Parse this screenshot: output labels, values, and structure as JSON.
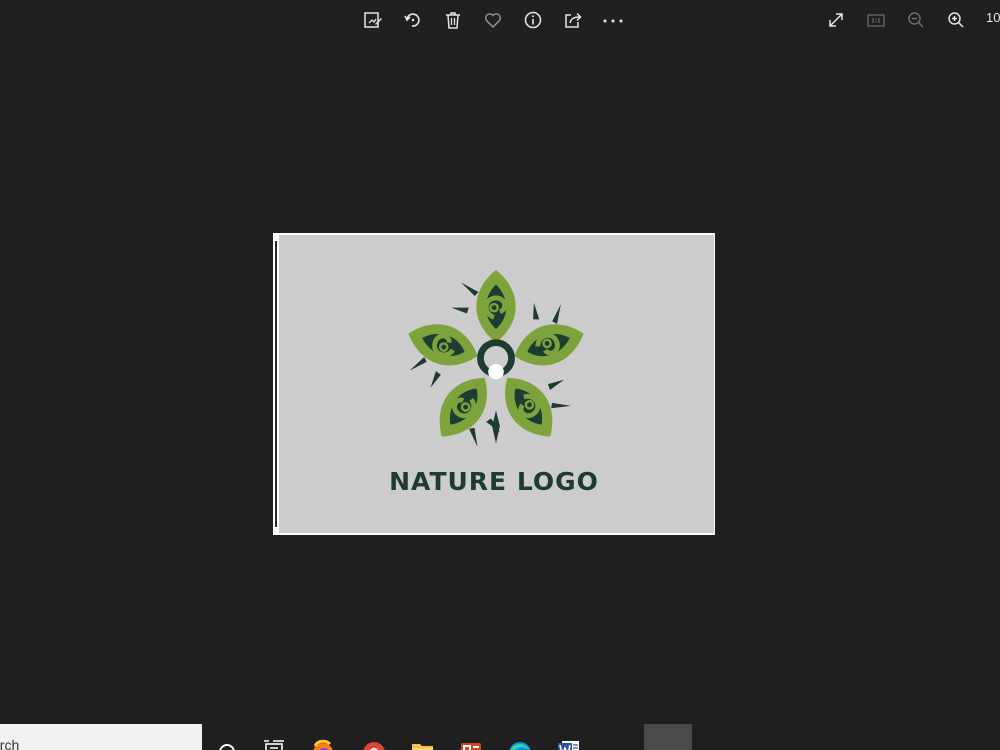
{
  "viewer": {
    "toolbar": {
      "zoom_level": "10",
      "left_tools": [
        "edit-create-icon",
        "rotate-icon",
        "delete-icon",
        "favorite-icon",
        "info-icon",
        "share-icon",
        "more-icon"
      ],
      "right_tools": [
        "fullscreen-icon",
        "actual-size-icon",
        "zoom-out-icon",
        "zoom-in-icon"
      ]
    },
    "image": {
      "logo_text": "NATURE LOGO",
      "background_color": "#cdcdcd",
      "colors": {
        "light_green": "#7ea23c",
        "dark_green": "#1e3b30",
        "mid_green": "#5e8a2e"
      }
    }
  },
  "taskbar": {
    "search_text": "arch",
    "apps": [
      "cortana-icon",
      "task-view-icon",
      "firefox-icon",
      "chrome-icon",
      "file-explorer-icon",
      "powerpoint-icon",
      "edge-icon",
      "word-icon"
    ]
  }
}
